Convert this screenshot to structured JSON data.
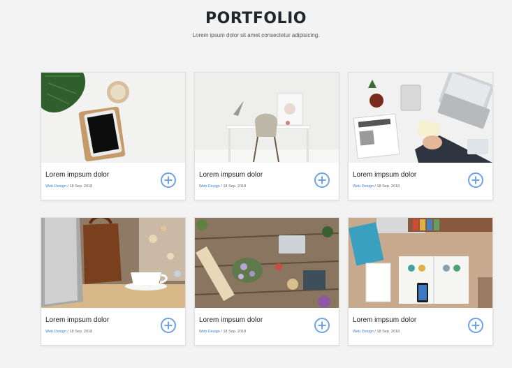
{
  "header": {
    "title": "PORTFOLIO",
    "subtitle": "Lorem ipsum dolor sit amet consectetur adipisicing."
  },
  "cards": [
    {
      "title": "Lorem impsum dolor",
      "category": "Web Design",
      "date": " / 18 Sep. 2018",
      "image": "tablet-plant-coffee"
    },
    {
      "title": "Lorem impsum dolor",
      "category": "Web Design",
      "date": " / 18 Sep. 2018",
      "image": "white-desk-chair"
    },
    {
      "title": "Lorem impsum dolor",
      "category": "Web Design",
      "date": " / 18 Sep. 2018",
      "image": "business-desk-laptop"
    },
    {
      "title": "Lorem impsum dolor",
      "category": "Web Design",
      "date": " / 18 Sep. 2018",
      "image": "laptop-bag-cup"
    },
    {
      "title": "Lorem impsum dolor",
      "category": "Web Design",
      "date": " / 18 Sep. 2018",
      "image": "craft-table-flowers"
    },
    {
      "title": "Lorem impsum dolor",
      "category": "Web Design",
      "date": " / 18 Sep. 2018",
      "image": "design-notebook-phone"
    }
  ],
  "colors": {
    "accent": "#6fa0ea",
    "link": "#3d7de0",
    "background": "#f3f3f3"
  }
}
